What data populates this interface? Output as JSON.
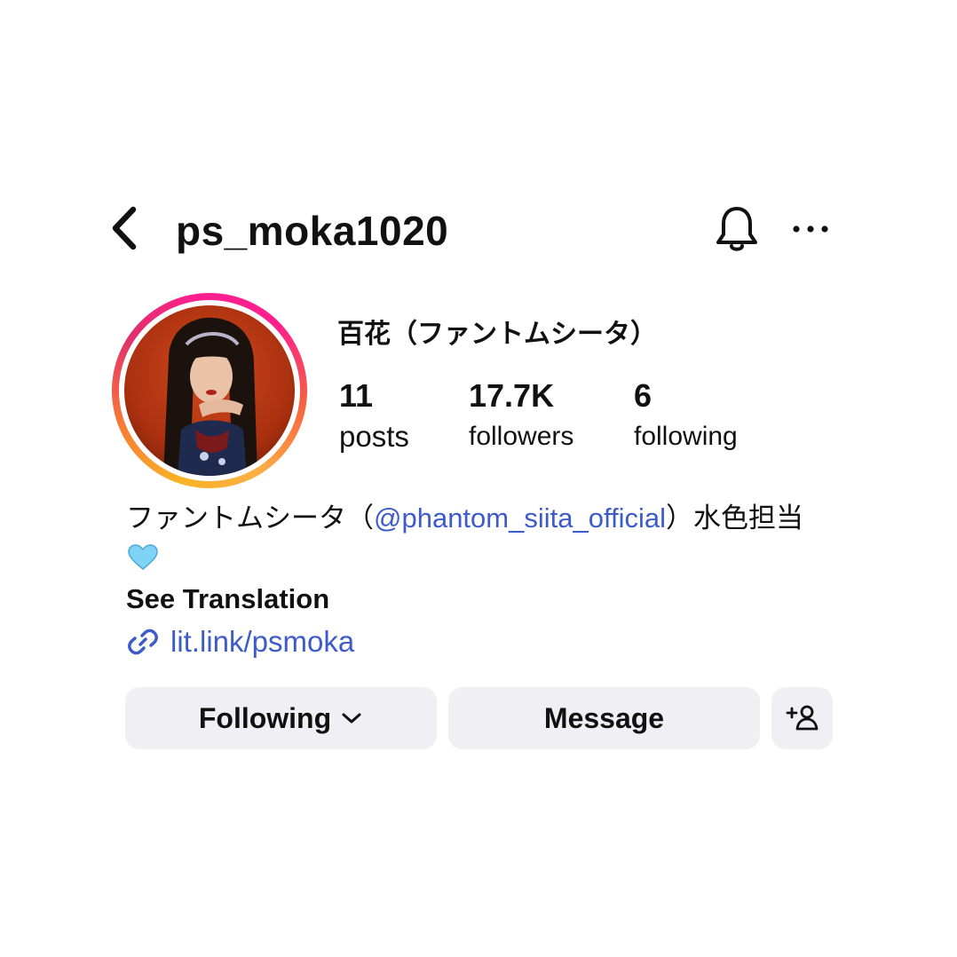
{
  "header": {
    "username": "ps_moka1020",
    "back_icon": "chevron-left-icon",
    "notification_icon": "bell-icon",
    "more_icon": "more-horizontal-icon"
  },
  "profile": {
    "display_name": "百花（ファントムシータ）",
    "avatar_ring_colors": [
      "#fcaf45",
      "#f77737",
      "#e1306c",
      "#ff1f8e"
    ],
    "stats": {
      "posts": {
        "value": "11",
        "label": "posts"
      },
      "followers": {
        "value": "17.7K",
        "label": "followers"
      },
      "following": {
        "value": "6",
        "label": "following"
      }
    },
    "bio": {
      "prefix": "ファントムシータ（",
      "mention": "@phantom_siita_official",
      "suffix": "）水色担当",
      "emoji": "🩵",
      "see_translation": "See Translation"
    },
    "link": {
      "text": "lit.link/psmoka",
      "icon": "link-icon"
    }
  },
  "actions": {
    "following_label": "Following",
    "message_label": "Message",
    "add_user_icon": "add-user-icon"
  },
  "colors": {
    "link": "#3d5bc9",
    "button_bg": "#efeff4",
    "text": "#111111"
  }
}
